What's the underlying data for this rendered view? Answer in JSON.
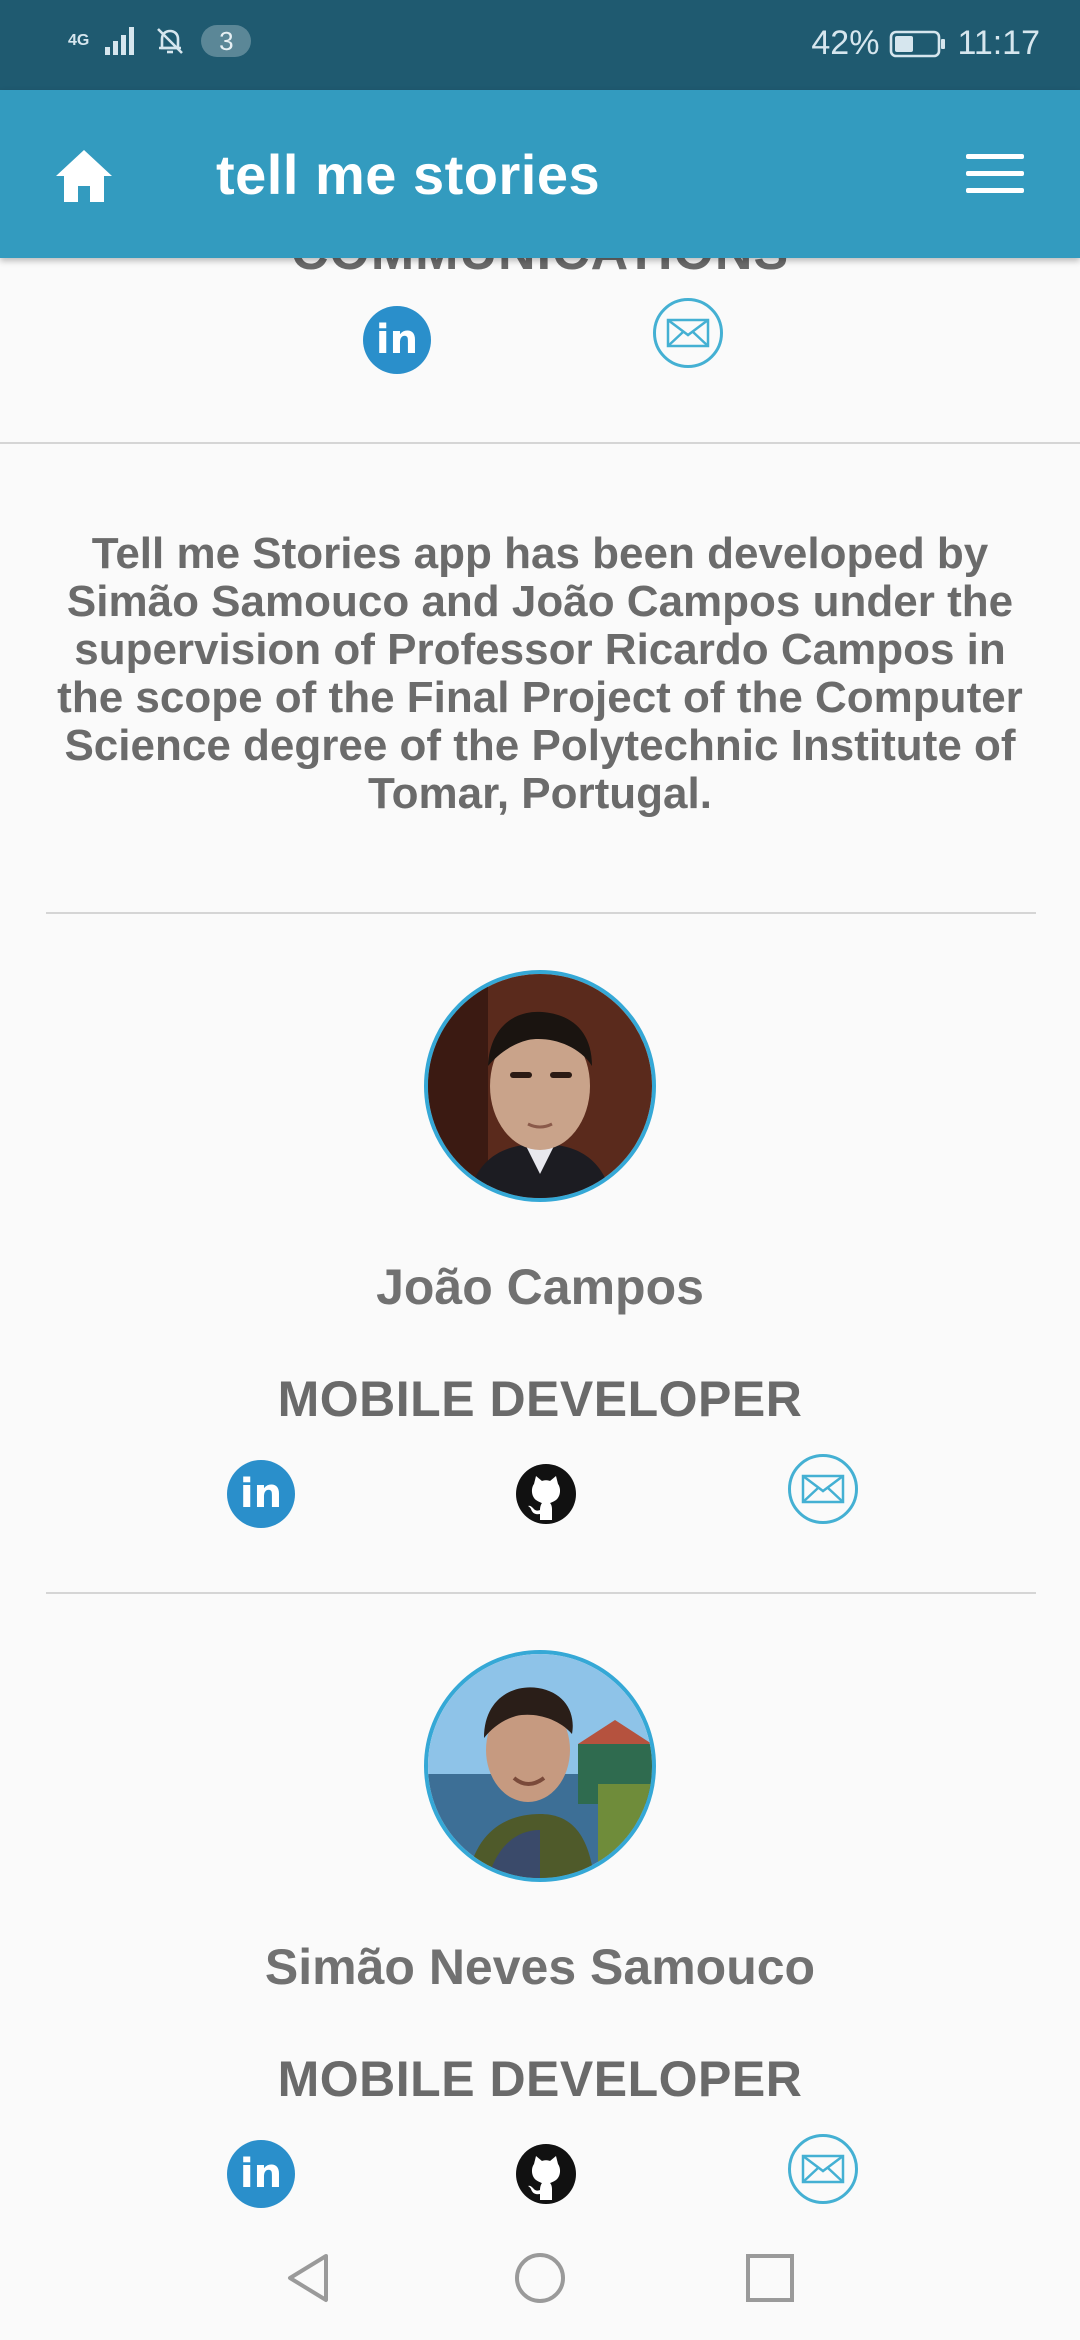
{
  "status_bar": {
    "network": "4G",
    "notification_count": "3",
    "battery": "42%",
    "time": "11:17"
  },
  "app_bar": {
    "title": "tell me stories",
    "home_icon": "home-icon",
    "menu_icon": "hamburger-menu-icon"
  },
  "top_section": {
    "heading_cut": "COMMUNICATIONS",
    "links": [
      "linkedin-icon",
      "email-icon"
    ]
  },
  "about": {
    "text": "Tell me Stories app has been developed by Simão Samouco and João Campos under the supervision of Professor Ricardo Campos in the scope of the Final Project of the Computer Science degree of the Polytechnic Institute of Tomar, Portugal."
  },
  "developers": [
    {
      "name": "João Campos",
      "role": "MOBILE DEVELOPER",
      "links": [
        "linkedin-icon",
        "github-icon",
        "email-icon"
      ]
    },
    {
      "name": "Simão Neves Samouco",
      "role": "MOBILE DEVELOPER",
      "links": [
        "linkedin-icon",
        "github-icon",
        "email-icon"
      ]
    }
  ],
  "nav_bar": {
    "buttons": [
      "back-triangle-icon",
      "home-circle-icon",
      "recents-square-icon"
    ]
  },
  "colors": {
    "status_bar": "#1f5a70",
    "app_bar": "#339bbf",
    "linkedin": "#2a8fcb",
    "accent_ring": "#35a8d6",
    "text_gray": "#6b6b6b"
  }
}
